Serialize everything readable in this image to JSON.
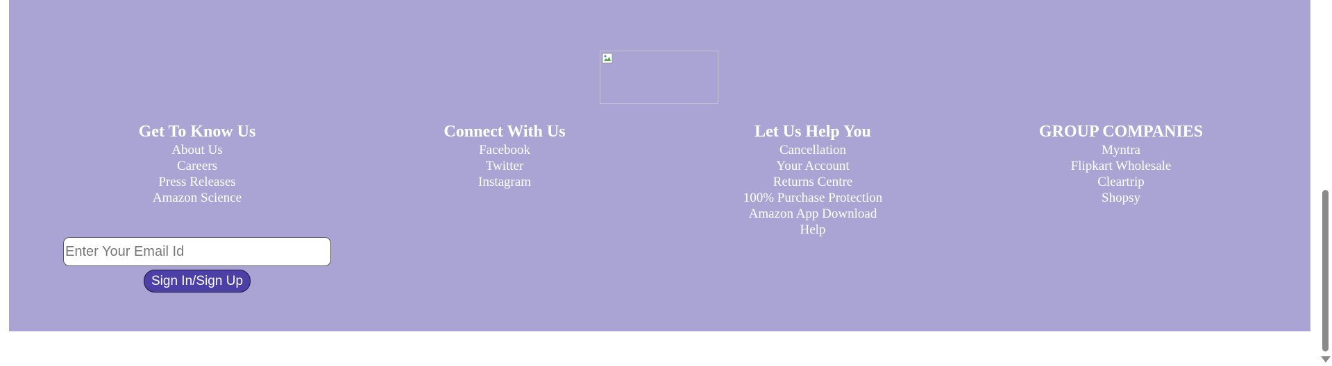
{
  "footer": {
    "background_color": "#a9a4d3",
    "logo_icon": "broken-image-icon",
    "columns": [
      {
        "title": "Get To Know Us",
        "links": [
          "About Us",
          "Careers",
          "Press Releases",
          "Amazon Science"
        ]
      },
      {
        "title": "Connect With Us",
        "links": [
          "Facebook",
          "Twitter",
          "Instagram"
        ]
      },
      {
        "title": "Let Us Help You",
        "links": [
          "Cancellation",
          "Your Account",
          "Returns Centre",
          "100% Purchase Protection",
          "Amazon App Download",
          "Help"
        ]
      },
      {
        "title": "GROUP COMPANIES",
        "links": [
          "Myntra",
          "Flipkart Wholesale",
          "Cleartrip",
          "Shopsy"
        ]
      }
    ],
    "newsletter": {
      "email_placeholder": "Enter Your Email Id",
      "email_value": "",
      "button_label": "Sign In/Sign Up",
      "button_color": "#4c3fa6"
    }
  },
  "scrollbar": {
    "down_icon": "scroll-down-arrow-icon"
  }
}
